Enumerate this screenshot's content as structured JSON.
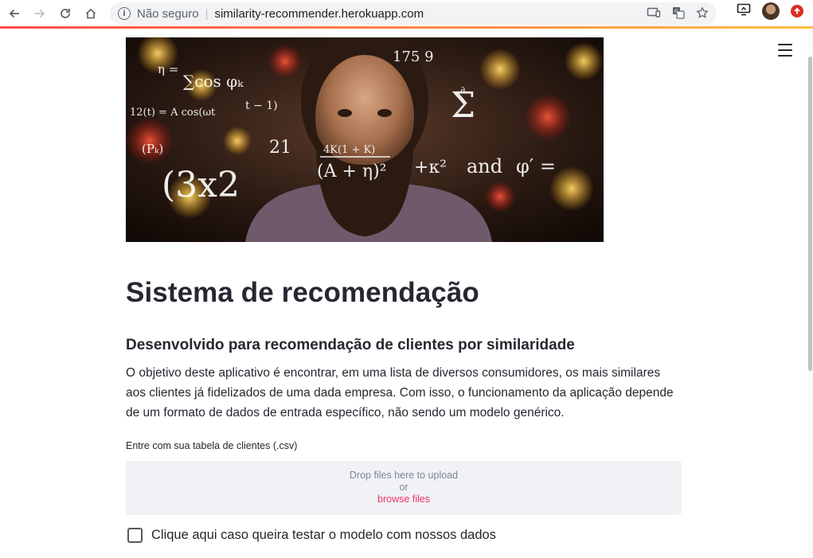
{
  "browser": {
    "security_label": "Não seguro",
    "separator": "|",
    "url": "similarity-recommender.herokuapp.com"
  },
  "page": {
    "hero_image": {
      "overlay_text": [
        "η =",
        "∑cos φₖ",
        "175 9",
        "12(t) = A cos(ωt",
        "4K(1 + K)",
        "(Pₖ)",
        "21",
        "(A + η)²",
        "+κ² and φ' =",
        "(3x2",
        "t - 1"
      ]
    },
    "title": "Sistema de recomendação",
    "subtitle": "Desenvolvido para recomendação de clientes por similaridade",
    "description": "O objetivo deste aplicativo é encontrar, em uma lista de diversos consumidores, os mais similares aos clientes já fidelizados de uma dada empresa. Com isso, o funcionamento da aplicação depende de um formato de dados de entrada específico, não sendo um modelo genérico.",
    "uploader": {
      "label": "Entre com sua tabela de clientes (.csv)",
      "drop_text": "Drop files here to upload",
      "or_text": "or",
      "browse_text": "browse files"
    },
    "checkbox": {
      "label": "Clique aqui caso queira testar o modelo com nossos dados",
      "checked": false
    }
  },
  "colors": {
    "accent": "#f63366",
    "text": "#262730",
    "dropzone_bg": "#f0f2f6"
  },
  "icons": [
    "back-icon",
    "forward-icon",
    "reload-icon",
    "home-icon",
    "info-icon",
    "cast-icon",
    "translate-icon",
    "star-icon",
    "screen-share-icon",
    "update-icon",
    "hamburger-menu-icon"
  ]
}
